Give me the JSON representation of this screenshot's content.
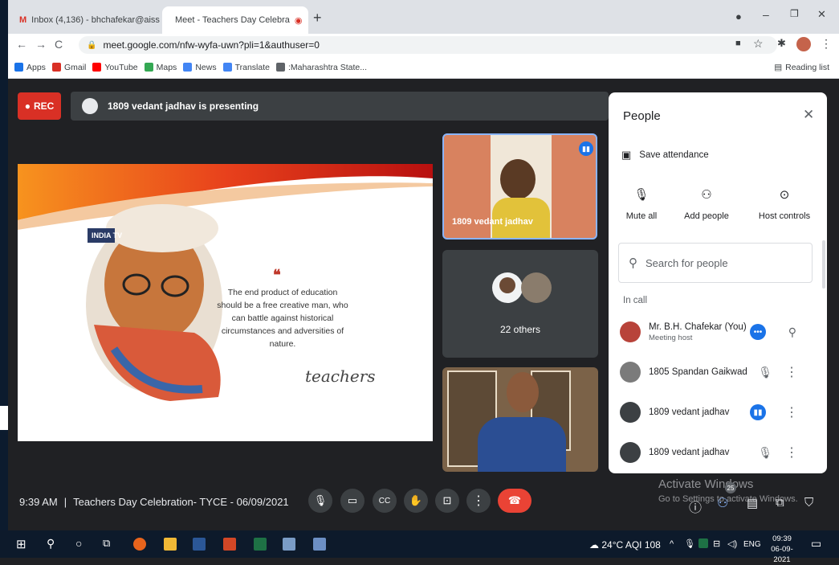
{
  "browser": {
    "tabs": [
      {
        "label": "Inbox (4,136) - bhchafekar@aiss"
      },
      {
        "label": "Meet - Teachers Day Celebra"
      }
    ],
    "url": "meet.google.com/nfw-wyfa-uwn?pli=1&authuser=0",
    "bookmarks": [
      "Apps",
      "Gmail",
      "YouTube",
      "Maps",
      "News",
      "Translate",
      ":Maharashtra State..."
    ],
    "reading_list": "Reading list"
  },
  "meeting": {
    "rec_label": "REC",
    "presenting_text": "1809 vedant jadhav is presenting",
    "slide": {
      "quote": "The end product of education should be a free creative man, who can battle against historical circumstances and adversities of nature.",
      "logo": "INDIA TV",
      "signature": "teachers"
    },
    "tiles": {
      "presenter_name": "1809 vedant jadhav",
      "others_label": "22 others"
    },
    "time": "9:39 AM",
    "title": "Teachers Day Celebration- TYCE - 06/09/2021",
    "people_count": "25"
  },
  "people_panel": {
    "title": "People",
    "save_attendance": "Save attendance",
    "actions": [
      "Mute all",
      "Add people",
      "Host controls"
    ],
    "search_placeholder": "Search for people",
    "section": "In call",
    "people": [
      {
        "name": "Mr. B.H. Chafekar (You)",
        "sub": "Meeting host"
      },
      {
        "name": "1805 Spandan Gaikwad",
        "sub": ""
      },
      {
        "name": "1809 vedant jadhav",
        "sub": ""
      },
      {
        "name": "1809 vedant jadhav",
        "sub": ""
      }
    ]
  },
  "watermark": {
    "line1": "Activate Windows",
    "line2": "Go to Settings to activate Windows."
  },
  "taskbar": {
    "weather": "24°C  AQI 108",
    "lang": "ENG",
    "time": "09:39",
    "date": "06-09-2021"
  },
  "colors": {
    "record": "#d93025",
    "accent": "#1a73e8",
    "meet_bg": "#202124"
  }
}
